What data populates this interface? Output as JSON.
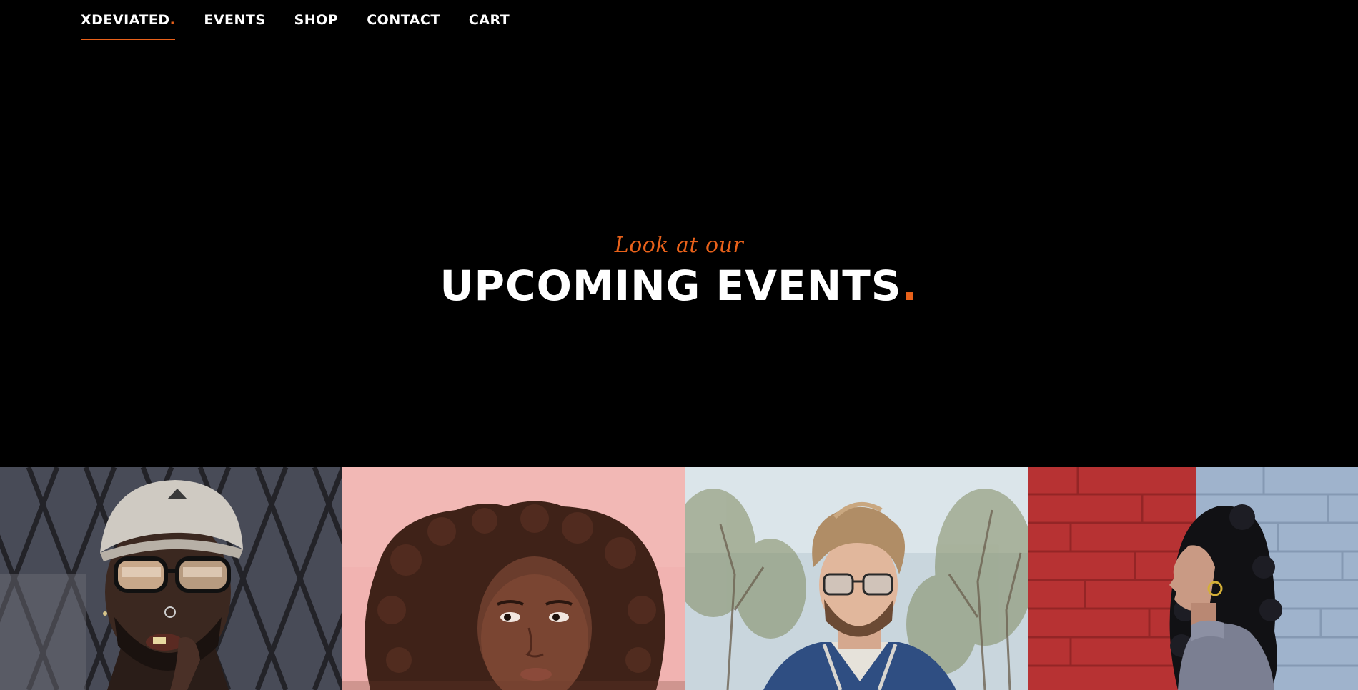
{
  "nav": {
    "brand": "XDEVIATED",
    "brand_dot": ".",
    "items": [
      {
        "label": "EVENTS"
      },
      {
        "label": "SHOP"
      },
      {
        "label": "CONTACT"
      },
      {
        "label": "CART"
      }
    ]
  },
  "hero": {
    "kicker": "Look at our",
    "title": "UPCOMING EVENTS",
    "title_dot": "."
  },
  "gallery": {
    "photos": [
      {
        "name": "man-cap-glasses-photo"
      },
      {
        "name": "woman-afro-pink-photo"
      },
      {
        "name": "man-glasses-trees-photo"
      },
      {
        "name": "woman-curly-brick-photo"
      }
    ]
  },
  "colors": {
    "background": "#000000",
    "accent": "#e8611a",
    "text": "#ffffff"
  }
}
